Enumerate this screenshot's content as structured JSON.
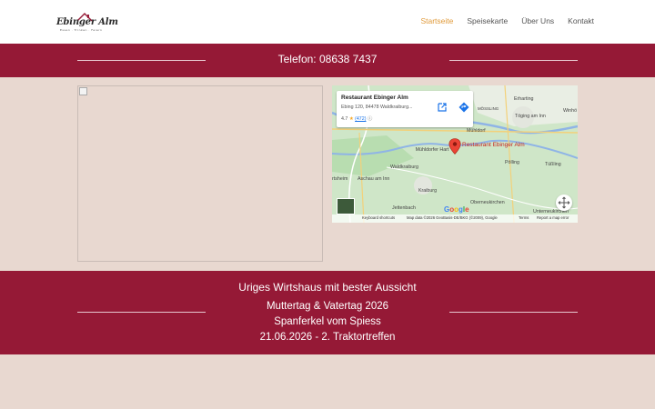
{
  "header": {
    "logo_text": "Ebinger Alm",
    "logo_subtitle": "Essen · Trinken · Feiern",
    "nav": [
      {
        "label": "Startseite",
        "active": true
      },
      {
        "label": "Speisekarte",
        "active": false
      },
      {
        "label": "Über Uns",
        "active": false
      },
      {
        "label": "Kontakt",
        "active": false
      }
    ]
  },
  "phone_band": {
    "text": "Telefon: 08638 7437"
  },
  "map": {
    "card": {
      "title": "Restaurant Ebinger Alm",
      "address": "Ebing 120, 84478 Waldkraiburg...",
      "rating": "4.7",
      "reviews": "(472)",
      "open_icon": "open-external-icon",
      "directions_icon": "directions-icon",
      "info_icon": "info-icon"
    },
    "pin_label": "Restaurant Ebinger Alm",
    "places": [
      "Erharting",
      "MÖSSLING",
      "Töging am Inn",
      "Mühldorf",
      "Winhö",
      "Mühldorfer Hart",
      "Waldkraiburg",
      "Pölling",
      "Tüßling",
      "Aschau am Inn",
      "rtsheim",
      "Kraiburg",
      "Oberneukirchen",
      "Jettenbach",
      "Unterneukirchen"
    ],
    "google": "Google",
    "footer": {
      "shortcuts": "Keyboard shortcuts",
      "attribution": "Map data ©2026 GeoBasis-DE/BKG (©2009), Google",
      "terms": "Terms",
      "report": "Report a map error"
    }
  },
  "info_band": {
    "title": "Uriges Wirtshaus mit bester Aussicht",
    "lines": [
      "Muttertag & Vatertag 2026",
      "Spanferkel vom Spiess",
      "21.06.2026 - 2. Traktortreffen"
    ]
  },
  "colors": {
    "brand": "#951936",
    "page_bg": "#e8d8d0",
    "nav_active": "#e09a3a"
  }
}
